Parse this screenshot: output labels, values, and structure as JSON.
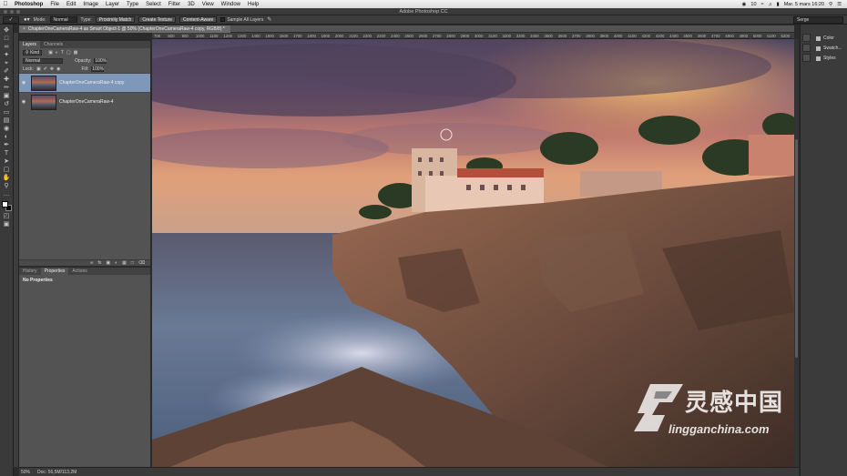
{
  "menubar": {
    "items": [
      "Photoshop",
      "File",
      "Edit",
      "Image",
      "Layer",
      "Type",
      "Select",
      "Filter",
      "3D",
      "View",
      "Window",
      "Help"
    ],
    "status": [
      "10",
      "Mar. 5 mars 16:20"
    ]
  },
  "window": {
    "title": "Adobe Photoshop CC"
  },
  "options": {
    "mode_label": "Mode:",
    "mode_value": "Normal",
    "type_label": "Type:",
    "proximity_label": "Proximity Match",
    "create_texture_label": "Create Texture",
    "content_aware_label": "Content-Aware",
    "sample_all_label": "Sample All Layers",
    "workspace_value": "Serge"
  },
  "document": {
    "tab_title": "ChapterOneCameraRaw-4 as Smart Object-1 @ 50% (ChapterOneCameraRaw-4 copy, RGB/8) *",
    "ruler_ticks": [
      "700",
      "800",
      "900",
      "1000",
      "1100",
      "1200",
      "1300",
      "1400",
      "1500",
      "1600",
      "1700",
      "1800",
      "1900",
      "2000",
      "2100",
      "2200",
      "2300",
      "2400",
      "2500",
      "2600",
      "2700",
      "2800",
      "2900",
      "3000",
      "3100",
      "3200",
      "3300",
      "3400",
      "3500",
      "3600",
      "3700",
      "3800",
      "3900",
      "4000",
      "4100",
      "4200",
      "4300",
      "4400",
      "4500",
      "4600",
      "4700",
      "4800",
      "4900",
      "5000",
      "5100",
      "5200",
      "5300"
    ]
  },
  "layers_panel": {
    "tabs": [
      "Layers",
      "Channels"
    ],
    "filter_kind": "Kind",
    "blend_mode": "Normal",
    "opacity_label": "Opacity:",
    "opacity_value": "100%",
    "lock_label": "Lock:",
    "fill_label": "Fill:",
    "fill_value": "100%",
    "layers": [
      {
        "name": "ChapterOneCameraRaw-4 copy",
        "selected": true
      },
      {
        "name": "ChapterOneCameraRaw-4",
        "selected": false
      }
    ]
  },
  "props_panel": {
    "tabs": [
      "History",
      "Properties",
      "Actions"
    ],
    "message": "No Properties"
  },
  "right_dock": {
    "items": [
      "Color",
      "Swatch...",
      "Styles"
    ]
  },
  "status": {
    "zoom": "50%",
    "doc_info": "Doc: 56,5M/113,2M"
  },
  "watermark": {
    "chinese": "灵感中国",
    "url": "lingganchina.com"
  }
}
